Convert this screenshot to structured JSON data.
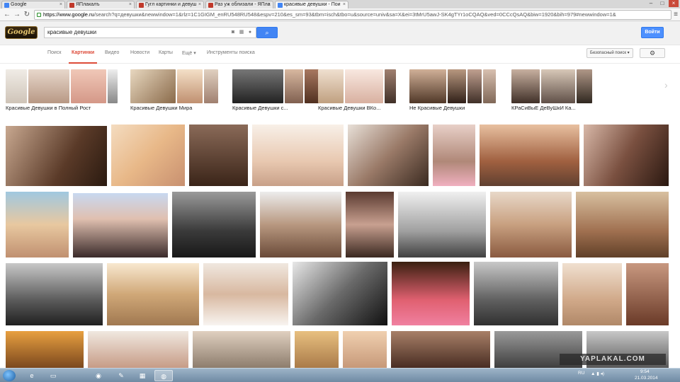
{
  "browser": {
    "tabs": [
      {
        "label": "Google",
        "fav_color": "#4285f4",
        "active": false
      },
      {
        "label": "ЯПлакалъ",
        "fav_color": "#c0392b",
        "active": false
      },
      {
        "label": "Гугл картинки и девуш",
        "fav_color": "#c0392b",
        "active": false
      },
      {
        "label": "Раз уж облизали - ЯПла",
        "fav_color": "#c0392b",
        "active": false
      },
      {
        "label": "красивые девушки - Пои",
        "fav_color": "#4285f4",
        "active": true
      }
    ],
    "url_host": "https://www.google.ru",
    "url_path": "/search?q=девушки&newwindow=1&rlz=1C1GIGM_enRU548RU548&espv=210&es_sm=93&tbm=isch&tbo=u&source=univ&sa=X&ei=3tMrU5awJ-SK4gTYr1oCQAQ&ved=0CCcQsAQ&biw=1920&bih=979#newwindow=1&"
  },
  "google": {
    "logo": "Google",
    "query": "красивые девушки",
    "signin_label": "Войти",
    "tabs": [
      "Поиск",
      "Картинки",
      "Видео",
      "Новости",
      "Карты",
      "Ещё ▾",
      "Инструменты поиска"
    ],
    "selected_tab": "Картинки",
    "safe_search": "Безопасный поиск ▾"
  },
  "related": [
    {
      "label": "Красивые Девушки в Полный Рост"
    },
    {
      "label": "Красивые Девушки Мира"
    },
    {
      "label": "Красивые Девушки с..."
    },
    {
      "label": "Красивые Девушки ВКо..."
    },
    {
      "label": "Не Красивые Девушки"
    },
    {
      "label": "КРаСиВыЕ ДеВуШкИ Ка..."
    }
  ],
  "taskbar": {
    "lang": "RU",
    "time": "9:54",
    "date": "21.03.2014"
  },
  "watermark": "YAPLAKAL.COM"
}
